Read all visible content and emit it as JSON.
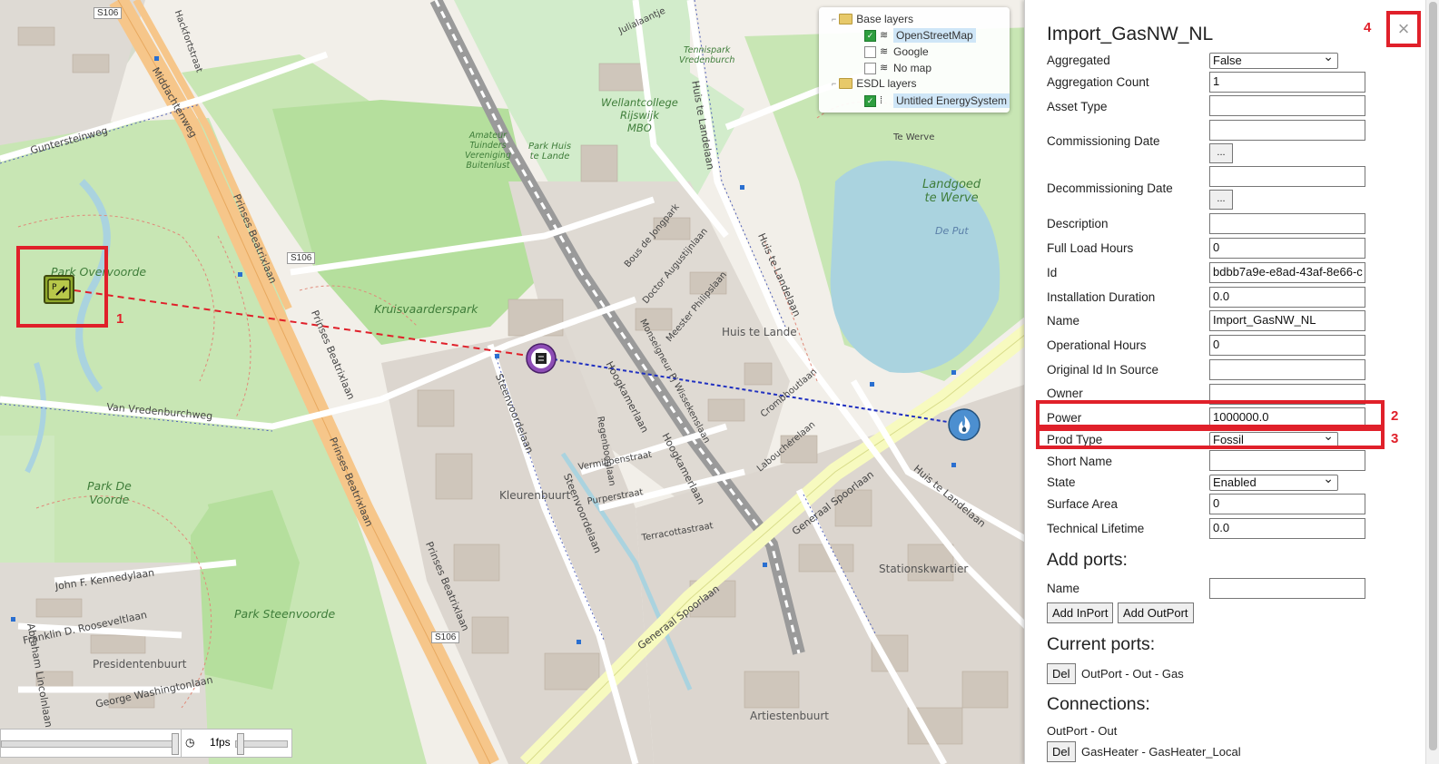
{
  "map": {
    "labels": {
      "middachtenweg": "Middachtenweg",
      "prinses_beatrixlaan": "Prinses Beatrixlaan",
      "park_overvoorde": "Park Overvoorde",
      "kruisvaarderspark": "Kruisvaarderspark",
      "park_de_voorde": "Park De\nVoorde",
      "park_steenvoorde": "Park Steenvoorde",
      "presidentenbuurt": "Presidentenbuurt",
      "kleurenbuurt": "Kleurenbuurt",
      "huis_te_lande": "Huis te Lande",
      "stationskwartier": "Stationskwartier",
      "artiestenbuurt": "Artiestenbuurt",
      "landgoed": "Landgoed\nte Werve",
      "de_put": "De Put",
      "te_werve": "Te Werve",
      "wellantcollege": "Wellantcollege\nRijswijk\nMBO",
      "park_huis_te_lande": "Park Huis\nte Lande",
      "amateur": "Amateur\nTuinders\nVereniging\nBuitenlust",
      "tennispark": "Tennispark\nVredenburch",
      "generaal_spoorlaan": "Generaal Spoorlaan",
      "huis_te_landelaan": "Huis te Landelaan",
      "s106_a": "S106",
      "s106_b": "S106",
      "s106_c": "S106",
      "van_vredenburchweg": "Van Vredenburchweg",
      "guntersteinweg": "Guntersteinweg",
      "steenvoordelaan": "Steenvoordelaan",
      "hoogkamerlaan": "Hoogkamerlaan",
      "john_f_kennedylaan": "John F. Kennedylaan",
      "franklin": "Franklin D. Rooseveltlaan",
      "george": "George Washingtonlaan",
      "abraham": "Abraham Lincolnlaan",
      "regenbooglaan": "Regenbooglaan",
      "vermiljoenstraat": "Vermiljoenstraat",
      "purperstraat": "Purperstraat",
      "terracottastraat": "Terracottastraat",
      "bous": "Bous de Jongpark",
      "doctor_aug": "Doctor Augustijnlaan",
      "meester": "Meester Philipslaan",
      "monseigneur": "Monseigneur Pj Wissekenslaan",
      "crombhoutlaan": "Crombhoutlaan",
      "labouchere": "Labouchérelaan",
      "julialaantje": "Julialaantje",
      "hackfortstraat": "Hackfortstraat",
      "middachtenweg2": "Middachtenweg"
    },
    "layers": {
      "base_title": "Base layers",
      "osm": "OpenStreetMap",
      "google": "Google",
      "nomap": "No map",
      "esdl_title": "ESDL layers",
      "untitled": "Untitled EnergySystem"
    },
    "annotations": {
      "n1": "1"
    },
    "fps": {
      "label": "1fps"
    }
  },
  "panel": {
    "title": "Import_GasNW_NL",
    "fields": {
      "aggregated": {
        "label": "Aggregated",
        "value": "False"
      },
      "aggregation_count": {
        "label": "Aggregation Count",
        "value": "1"
      },
      "asset_type": {
        "label": "Asset Type",
        "value": ""
      },
      "commissioning_date": {
        "label": "Commissioning Date",
        "value": "",
        "button": "..."
      },
      "decommissioning_date": {
        "label": "Decommissioning Date",
        "value": "",
        "button": "..."
      },
      "description": {
        "label": "Description",
        "value": ""
      },
      "full_load_hours": {
        "label": "Full Load Hours",
        "value": "0"
      },
      "id": {
        "label": "Id",
        "value": "bdbb7a9e-e8ad-43af-8e66-c"
      },
      "installation_duration": {
        "label": "Installation Duration",
        "value": "0.0"
      },
      "name": {
        "label": "Name",
        "value": "Import_GasNW_NL"
      },
      "operational_hours": {
        "label": "Operational Hours",
        "value": "0"
      },
      "original_id": {
        "label": "Original Id In Source",
        "value": ""
      },
      "owner": {
        "label": "Owner",
        "value": ""
      },
      "power": {
        "label": "Power",
        "value": "1000000.0"
      },
      "prod_type": {
        "label": "Prod Type",
        "value": "Fossil"
      },
      "short_name": {
        "label": "Short Name",
        "value": ""
      },
      "state": {
        "label": "State",
        "value": "Enabled"
      },
      "surface_area": {
        "label": "Surface Area",
        "value": "0"
      },
      "technical_lifetime": {
        "label": "Technical Lifetime",
        "value": "0.0"
      }
    },
    "add_ports": {
      "heading": "Add ports:",
      "name_label": "Name",
      "name_value": "",
      "add_inport": "Add InPort",
      "add_outport": "Add OutPort"
    },
    "current_ports": {
      "heading": "Current ports:",
      "del": "Del",
      "port": "OutPort - Out - Gas"
    },
    "connections": {
      "heading": "Connections:",
      "port": "OutPort - Out",
      "del": "Del",
      "connection": "GasHeater - GasHeater_Local"
    },
    "annotations": {
      "n2": "2",
      "n3": "3",
      "n4": "4"
    },
    "close": "×"
  }
}
